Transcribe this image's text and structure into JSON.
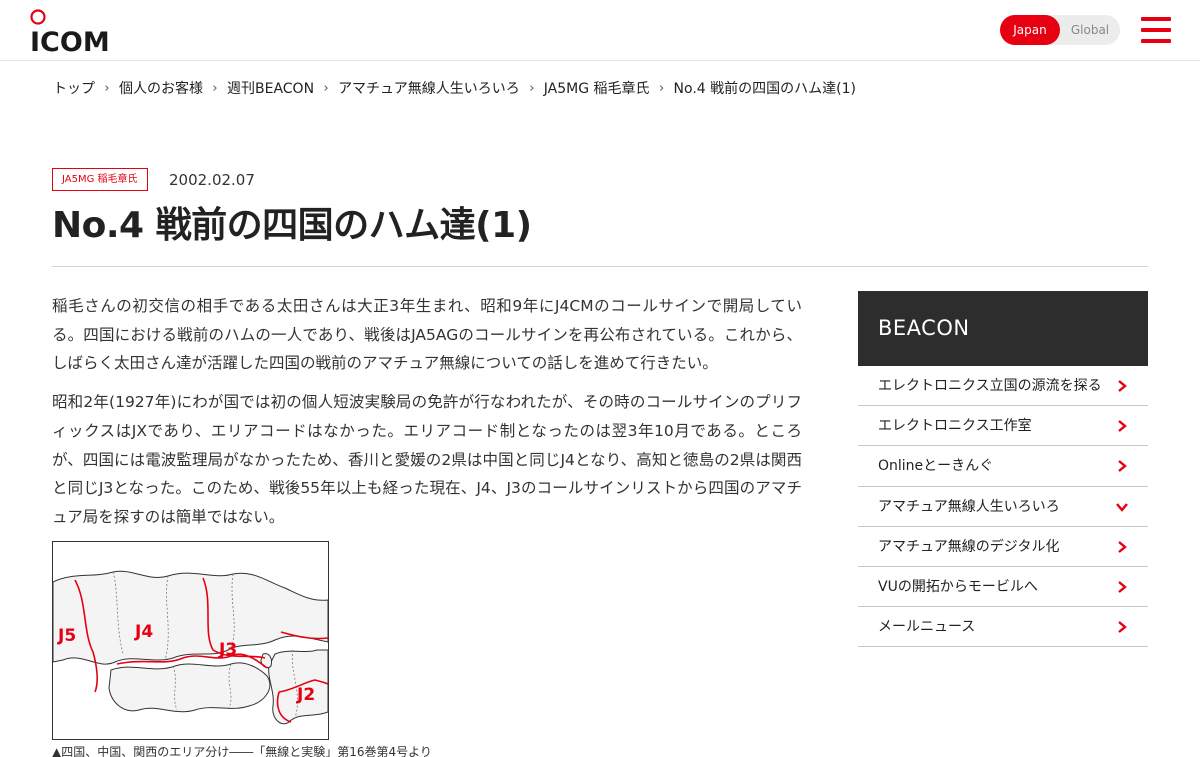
{
  "header": {
    "logo_text": "ICOM",
    "lang": {
      "active": "Japan",
      "inactive": "Global"
    },
    "brand_color": "#e60012",
    "menu_icon": "hamburger-menu-icon"
  },
  "breadcrumb": [
    "トップ",
    "個人のお客様",
    "週刊BEACON",
    "アマチュア無線人生いろいろ",
    "JA5MG 稲毛章氏",
    "No.4 戦前の四国のハム達(1)"
  ],
  "article": {
    "category": "JA5MG 稲毛章氏",
    "date": "2002.02.07",
    "title": "No.4 戦前の四国のハム達(1)",
    "paragraphs": [
      "稲毛さんの初交信の相手である太田さんは大正3年生まれ、昭和9年にJ4CMのコールサインで開局している。四国における戦前のハムの一人であり、戦後はJA5AGのコールサインを再公布されている。これから、しばらく太田さん達が活躍した四国の戦前のアマチュア無線についての話しを進めて行きたい。",
      "昭和2年(1927年)にわが国では初の個人短波実験局の免許が行なわれたが、その時のコールサインのプリフィックスはJXであり、エリアコードはなかった。エリアコード制となったのは翌3年10月である。ところが、四国には電波監理局がなかったため、香川と愛媛の2県は中国と同じJ4となり、高知と徳島の2県は関西と同じJ3となった。このため、戦後55年以上も経った現在、J4、J3のコールサインリストから四国のアマチュア局を探すのは簡単ではない。"
    ],
    "figure": {
      "labels": [
        "J5",
        "J4",
        "J3",
        "J2"
      ],
      "caption": "▲四国、中国、関西のエリア分け――「無線と実験」第16巻第4号より"
    }
  },
  "sidebar": {
    "title": "BEACON",
    "items": [
      {
        "label": "エレクトロニクス立国の源流を探る",
        "icon": "chevron-right-icon"
      },
      {
        "label": "エレクトロニクス工作室",
        "icon": "chevron-right-icon"
      },
      {
        "label": "Onlineとーきんぐ",
        "icon": "chevron-right-icon"
      },
      {
        "label": "アマチュア無線人生いろいろ",
        "icon": "chevron-down-icon"
      },
      {
        "label": "アマチュア無線のデジタル化",
        "icon": "chevron-right-icon"
      },
      {
        "label": "VUの開拓からモービルへ",
        "icon": "chevron-right-icon"
      },
      {
        "label": "メールニュース",
        "icon": "chevron-right-icon"
      }
    ]
  }
}
